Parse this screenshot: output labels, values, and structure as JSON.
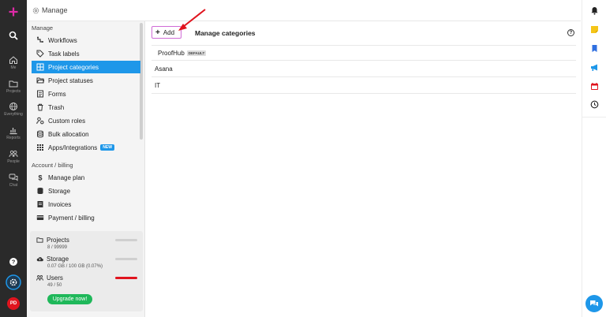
{
  "header": {
    "title": "Manage"
  },
  "rail": {
    "items": [
      {
        "label": "Me"
      },
      {
        "label": "Projects"
      },
      {
        "label": "Everything"
      },
      {
        "label": "Reports"
      },
      {
        "label": "People"
      },
      {
        "label": "Chat"
      }
    ],
    "avatar": "PD"
  },
  "sidebar": {
    "section_manage": "Manage",
    "manage_items": [
      {
        "label": "Workflows"
      },
      {
        "label": "Task labels"
      },
      {
        "label": "Project categories"
      },
      {
        "label": "Project statuses"
      },
      {
        "label": "Forms"
      },
      {
        "label": "Trash"
      },
      {
        "label": "Custom roles"
      },
      {
        "label": "Bulk allocation"
      },
      {
        "label": "Apps/Integrations",
        "badge": "NEW"
      }
    ],
    "section_account": "Account / billing",
    "account_items": [
      {
        "label": "Manage plan"
      },
      {
        "label": "Storage"
      },
      {
        "label": "Invoices"
      },
      {
        "label": "Payment / billing"
      }
    ]
  },
  "usage": {
    "projects": {
      "label": "Projects",
      "value": "8 / 99999"
    },
    "storage": {
      "label": "Storage",
      "value": "0.07 GB / 100 GB (0.07%)"
    },
    "users": {
      "label": "Users",
      "value": "49 / 50"
    },
    "upgrade_label": "Upgrade now!"
  },
  "main": {
    "add_label": "Add",
    "title": "Manage categories",
    "categories": [
      {
        "name": "ProofHub",
        "tag": "DEFAULT"
      },
      {
        "name": "Asana"
      },
      {
        "name": "IT"
      }
    ]
  },
  "colors": {
    "accent": "#1e97e9",
    "rail_bg": "#2a2a2a",
    "brand_plus": "#e02aa8",
    "upgrade": "#1fb85a",
    "alert": "#e0141e"
  }
}
